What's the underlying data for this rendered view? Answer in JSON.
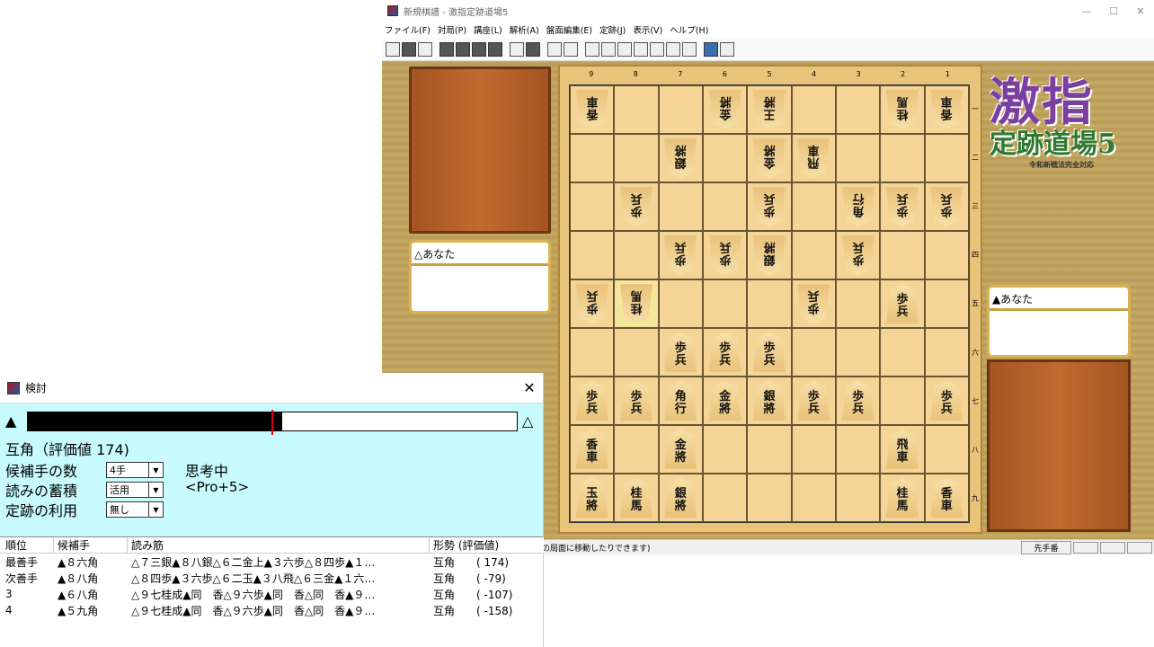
{
  "app": {
    "title": "新規棋譜 - 激指定跡道場5",
    "window_controls": [
      "—",
      "☐",
      "✕"
    ],
    "menu": [
      "ファイル(F)",
      "対局(P)",
      "講座(L)",
      "解析(A)",
      "盤面編集(E)",
      "定跡(J)",
      "表示(V)",
      "ヘルプ(H)"
    ]
  },
  "players": {
    "gote": "△あなた",
    "sente": "▲あなた"
  },
  "board": {
    "files": [
      "9",
      "8",
      "7",
      "6",
      "5",
      "4",
      "3",
      "2",
      "1"
    ],
    "ranks": [
      "一",
      "二",
      "三",
      "四",
      "五",
      "六",
      "七",
      "八",
      "九"
    ],
    "pieces": [
      {
        "f": 9,
        "r": 1,
        "k": "香車",
        "s": "g"
      },
      {
        "f": 6,
        "r": 1,
        "k": "金將",
        "s": "g"
      },
      {
        "f": 5,
        "r": 1,
        "k": "王將",
        "s": "g"
      },
      {
        "f": 2,
        "r": 1,
        "k": "桂馬",
        "s": "g"
      },
      {
        "f": 1,
        "r": 1,
        "k": "香車",
        "s": "g"
      },
      {
        "f": 7,
        "r": 2,
        "k": "銀將",
        "s": "g"
      },
      {
        "f": 5,
        "r": 2,
        "k": "金將",
        "s": "g"
      },
      {
        "f": 4,
        "r": 2,
        "k": "飛車",
        "s": "g"
      },
      {
        "f": 8,
        "r": 3,
        "k": "歩兵",
        "s": "g"
      },
      {
        "f": 5,
        "r": 3,
        "k": "歩兵",
        "s": "g"
      },
      {
        "f": 3,
        "r": 3,
        "k": "角行",
        "s": "g"
      },
      {
        "f": 2,
        "r": 3,
        "k": "歩兵",
        "s": "g"
      },
      {
        "f": 1,
        "r": 3,
        "k": "歩兵",
        "s": "g"
      },
      {
        "f": 7,
        "r": 4,
        "k": "歩兵",
        "s": "g"
      },
      {
        "f": 6,
        "r": 4,
        "k": "歩兵",
        "s": "g"
      },
      {
        "f": 5,
        "r": 4,
        "k": "銀將",
        "s": "g"
      },
      {
        "f": 3,
        "r": 4,
        "k": "歩兵",
        "s": "g"
      },
      {
        "f": 9,
        "r": 5,
        "k": "歩兵",
        "s": "g"
      },
      {
        "f": 8,
        "r": 5,
        "k": "桂馬",
        "s": "g"
      },
      {
        "f": 4,
        "r": 5,
        "k": "歩兵",
        "s": "g"
      },
      {
        "f": 2,
        "r": 5,
        "k": "歩兵",
        "s": "s"
      },
      {
        "f": 7,
        "r": 6,
        "k": "歩兵",
        "s": "s"
      },
      {
        "f": 6,
        "r": 6,
        "k": "歩兵",
        "s": "s"
      },
      {
        "f": 5,
        "r": 6,
        "k": "歩兵",
        "s": "s"
      },
      {
        "f": 9,
        "r": 7,
        "k": "歩兵",
        "s": "s"
      },
      {
        "f": 8,
        "r": 7,
        "k": "歩兵",
        "s": "s"
      },
      {
        "f": 7,
        "r": 7,
        "k": "角行",
        "s": "s"
      },
      {
        "f": 6,
        "r": 7,
        "k": "金將",
        "s": "s"
      },
      {
        "f": 5,
        "r": 7,
        "k": "銀將",
        "s": "s"
      },
      {
        "f": 4,
        "r": 7,
        "k": "歩兵",
        "s": "s"
      },
      {
        "f": 3,
        "r": 7,
        "k": "歩兵",
        "s": "s"
      },
      {
        "f": 1,
        "r": 7,
        "k": "歩兵",
        "s": "s"
      },
      {
        "f": 9,
        "r": 8,
        "k": "香車",
        "s": "s"
      },
      {
        "f": 7,
        "r": 8,
        "k": "金將",
        "s": "s"
      },
      {
        "f": 2,
        "r": 8,
        "k": "飛車",
        "s": "s"
      },
      {
        "f": 9,
        "r": 9,
        "k": "玉將",
        "s": "s"
      },
      {
        "f": 8,
        "r": 9,
        "k": "桂馬",
        "s": "s"
      },
      {
        "f": 7,
        "r": 9,
        "k": "銀將",
        "s": "s"
      },
      {
        "f": 2,
        "r": 9,
        "k": "桂馬",
        "s": "s"
      },
      {
        "f": 1,
        "r": 9,
        "k": "香車",
        "s": "s"
      }
    ],
    "highlight": {
      "f": 8,
      "r": 5
    }
  },
  "logo": {
    "line1": "激指",
    "line2": "定跡道場5",
    "line3": "令和新戦法完全対応"
  },
  "status": {
    "message": "の局面に移動したりできます)",
    "teban": "先手番"
  },
  "panel": {
    "title": "検討",
    "close": "✕",
    "eval_fraction": 0.52,
    "sente_symbol": "▲",
    "gote_symbol": "△",
    "eval_text": "互角（評価値 174)",
    "opt1_label": "候補手の数",
    "opt1_value": "4手",
    "opt2_label": "読みの蓄積",
    "opt2_value": "活用",
    "opt3_label": "定跡の利用",
    "opt3_value": "無し",
    "thinking": "思考中",
    "engine": "<Pro+5>",
    "columns": [
      "順位",
      "候補手",
      "読み筋",
      "形勢 (評価値)"
    ],
    "rows": [
      [
        "最善手",
        "▲８六角",
        "△７三銀▲８八銀△６二金上▲３六歩△８四歩▲１…",
        "互角　　(  174)"
      ],
      [
        "次善手",
        "▲８八角",
        "△８四歩▲３六歩△６二玉▲３八飛△６三金▲１六…",
        "互角　　(  -79)"
      ],
      [
        " 3",
        "▲６八角",
        "△９七桂成▲同　香△９六歩▲同　香△同　香▲９…",
        "互角　　( -107)"
      ],
      [
        " 4",
        "▲５九角",
        "△９七桂成▲同　香△９六歩▲同　香△同　香▲９…",
        "互角　　( -158)"
      ]
    ]
  },
  "colors": {
    "panel_bg": "#c7fbfe",
    "eval_marker": "#d00000",
    "stand": "#b8602a"
  }
}
